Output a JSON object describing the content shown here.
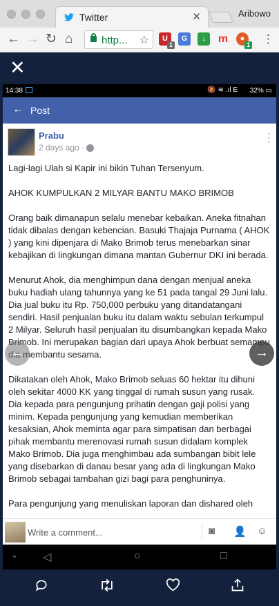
{
  "browser": {
    "tab_title": "Twitter",
    "tab_close": "✕",
    "profile_name": "Aribowo",
    "url_display": "http...",
    "ext_badges": [
      "1",
      "1"
    ]
  },
  "overlay": {
    "close_label": "✕"
  },
  "statusbar": {
    "time": "14:38",
    "battery": "32%"
  },
  "fb": {
    "header_title": "Post",
    "author": "Prabu",
    "meta": "2 days ago · ",
    "paragraphs": [
      "Lagi-lagi Ulah si Kapir ini bikin Tuhan Tersenyum.",
      "AHOK KUMPULKAN 2 MILYAR BANTU MAKO BRIMOB",
      "Orang baik dimanapun selalu menebar kebaikan. Aneka fitnahan tidak dibalas dengan kebencian. Basuki Thajaja Purnama ( AHOK ) yang kini dipenjara di Mako Brimob terus menebarkan sinar kebajikan di lingkungan dimana mantan Gubernur DKI ini berada.",
      "Menurut Ahok, dia menghimpun dana dengan menjual aneka buku hadiah ulang tahunnya yang ke 51 pada tangal 29 Juni lalu. Dia jual buku itu Rp. 750,000 perbuku yang ditandatangani sendiri. Hasil penjualan buku itu dalam waktu sebulan terkumpul 2 Milyar. Seluruh hasil penjualan itu disumbangkan kepada Mako Brimob. Ini merupakan bagian dari upaya Ahok berbuat semampu dia membantu sesama.",
      "Dikatakan oleh Ahok, Mako Brimob seluas 60 hektar itu dihuni oleh sekitar 4000 KK yang tinggal di rumah susun yang rusak. Dia kepada para pengunjung prihatin dengan gaji polisi yang minim. Kepada pengunjung yang kemudian memberikan kesaksian, Ahok meminta agar para simpatisan dan berbagai pihak membantu merenovasi rumah susun didalam komplek Mako Brimob. Dia juga menghimbau ada sumbangan bibit lele yang disebarkan di danau besar yang ada di lingkungan Mako Brimob sebagai tambahan gizi bagi para penghuninya.",
      "Para pengunjung yang menuliskan laporan dan dishared oleh"
    ],
    "comment_placeholder": "Write a comment..."
  },
  "icons": {
    "back": "back-arrow-icon",
    "forward": "forward-arrow-icon",
    "reload": "reload-icon",
    "home": "home-icon",
    "star": "star-icon",
    "reply": "reply-icon",
    "retweet": "retweet-icon",
    "like": "heart-icon",
    "share": "share-icon"
  }
}
